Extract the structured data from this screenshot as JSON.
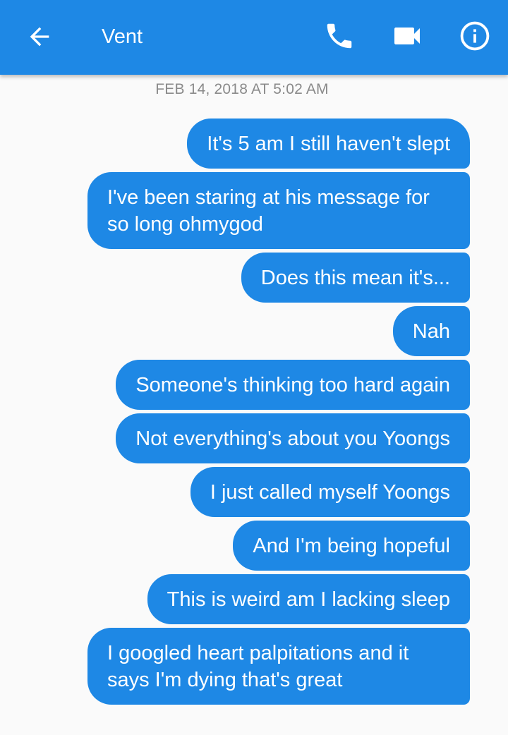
{
  "header": {
    "title": "Vent",
    "back_icon": "arrow-left-icon",
    "call_icon": "phone-icon",
    "video_icon": "video-camera-icon",
    "info_icon": "info-icon",
    "color": "#1e88e5"
  },
  "thread": {
    "timestamp": "FEB 14, 2018 AT 5:02 AM",
    "bubble_color": "#1e88e5",
    "messages": [
      {
        "text": "It's 5 am I still haven't slept"
      },
      {
        "text": "I've been staring at his message for so long ohmygod"
      },
      {
        "text": "Does this mean it's..."
      },
      {
        "text": "Nah"
      },
      {
        "text": "Someone's thinking too hard again"
      },
      {
        "text": "Not everything's about you Yoongs"
      },
      {
        "text": "I just called myself Yoongs"
      },
      {
        "text": "And I'm being hopeful"
      },
      {
        "text": "This is weird am I lacking sleep"
      },
      {
        "text": "I googled heart palpitations and it says I'm dying that's great"
      }
    ]
  }
}
